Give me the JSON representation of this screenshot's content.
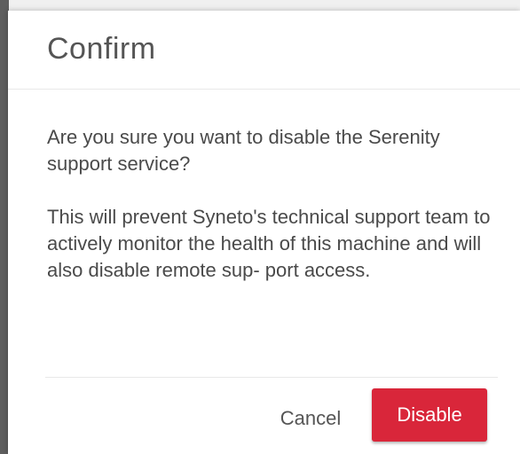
{
  "dialog": {
    "title": "Confirm",
    "message_question": "Are you sure you want to disable the Serenity support service?",
    "message_detail": "This will prevent Syneto's technical support team to actively monitor the health of this machine and will also disable remote sup- port access.",
    "cancel_label": "Cancel",
    "confirm_label": "Disable"
  },
  "colors": {
    "confirm_button": "#d9263a",
    "title_text": "#555555",
    "body_text": "#4a4a4a",
    "background": "#ffffff"
  }
}
